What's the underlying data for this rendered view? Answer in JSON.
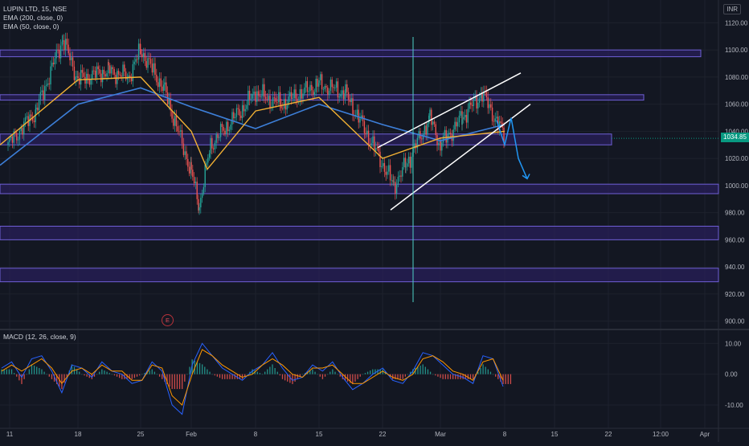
{
  "header": {
    "symbol_title": "LUPIN LTD, 15, NSE",
    "indicator_ema200": "EMA (200, close, 0)",
    "indicator_ema50": "EMA (50, close, 0)",
    "currency": "INR",
    "macd_label": "MACD (12, 26, close, 9)",
    "earnings_marker": "E",
    "last_price": "1034.85"
  },
  "colors": {
    "background": "#131722",
    "grid": "#1e222d",
    "zone_fill": "#2a1f5c",
    "zone_border": "#6f5fd6",
    "ema200": "#3d7fd9",
    "ema50": "#f2b134",
    "candle_up": "#26a69a",
    "candle_down": "#ef5350",
    "channel": "#ffffff",
    "projection": "#2196f3",
    "cursor_line": "#4dd0c5",
    "macd_line": "#2962ff",
    "signal_line": "#ff9800",
    "price_tag": "#089981"
  },
  "chart_data": [
    {
      "type": "candlestick",
      "title": "LUPIN LTD, 15, NSE",
      "x_tick_labels": [
        "11",
        "18",
        "25",
        "Feb",
        "8",
        "15",
        "22",
        "Mar",
        "8",
        "15",
        "22",
        "12:00",
        "Apr"
      ],
      "y_tick_labels": [
        "1120.00",
        "1100.00",
        "1080.00",
        "1060.00",
        "1040.00",
        "1020.00",
        "1000.00",
        "980.00",
        "960.00",
        "940.00",
        "920.00",
        "900.00"
      ],
      "ylim": [
        895,
        1125
      ],
      "grid": true,
      "last_price": 1034.85,
      "horizontal_zones": [
        {
          "low": 1095,
          "high": 1100
        },
        {
          "low": 1063,
          "high": 1067
        },
        {
          "low": 1030,
          "high": 1038
        },
        {
          "low": 994,
          "high": 1001
        },
        {
          "low": 960,
          "high": 970
        },
        {
          "low": 929,
          "high": 939
        }
      ],
      "price_anchors": [
        {
          "x": "11",
          "price": 1030
        },
        {
          "x": "14",
          "price": 1055
        },
        {
          "x": "17",
          "price": 1108
        },
        {
          "x": "18",
          "price": 1078
        },
        {
          "x": "21",
          "price": 1085
        },
        {
          "x": "24",
          "price": 1080
        },
        {
          "x": "25",
          "price": 1100
        },
        {
          "x": "28",
          "price": 1070
        },
        {
          "x": "Feb",
          "price": 1010
        },
        {
          "x": "2",
          "price": 985
        },
        {
          "x": "4",
          "price": 1030
        },
        {
          "x": "8",
          "price": 1068
        },
        {
          "x": "11",
          "price": 1060
        },
        {
          "x": "15",
          "price": 1075
        },
        {
          "x": "16",
          "price": 1068
        },
        {
          "x": "19",
          "price": 1040
        },
        {
          "x": "22",
          "price": 1000
        },
        {
          "x": "24",
          "price": 1015
        },
        {
          "x": "27",
          "price": 1050
        },
        {
          "x": "Mar",
          "price": 1030
        },
        {
          "x": "3",
          "price": 1050
        },
        {
          "x": "6",
          "price": 1068
        },
        {
          "x": "8",
          "price": 1036
        }
      ],
      "ema_anchors": {
        "ema200": [
          {
            "x": "11",
            "price": 1015
          },
          {
            "x": "18",
            "price": 1060
          },
          {
            "x": "25",
            "price": 1072
          },
          {
            "x": "Feb",
            "price": 1058
          },
          {
            "x": "8",
            "price": 1042
          },
          {
            "x": "15",
            "price": 1060
          },
          {
            "x": "22",
            "price": 1045
          },
          {
            "x": "Mar",
            "price": 1033
          },
          {
            "x": "8",
            "price": 1045
          }
        ],
        "ema50": [
          {
            "x": "11",
            "price": 1030
          },
          {
            "x": "18",
            "price": 1078
          },
          {
            "x": "25",
            "price": 1080
          },
          {
            "x": "Feb",
            "price": 1040
          },
          {
            "x": "3",
            "price": 1012
          },
          {
            "x": "8",
            "price": 1055
          },
          {
            "x": "15",
            "price": 1065
          },
          {
            "x": "22",
            "price": 1020
          },
          {
            "x": "Mar",
            "price": 1035
          },
          {
            "x": "8",
            "price": 1040
          }
        ]
      },
      "rising_wedge": {
        "upper": [
          {
            "x": "21",
            "price": 1028
          },
          {
            "x": "11",
            "price": 1083
          }
        ],
        "lower": [
          {
            "x": "21",
            "price": 982
          },
          {
            "x": "12",
            "price": 1060
          }
        ]
      },
      "projection_path": [
        1048,
        1030,
        1050,
        1020,
        1005
      ]
    },
    {
      "type": "line",
      "title": "MACD (12, 26, close, 9)",
      "y_tick_labels": [
        "10.00",
        "0.00",
        "-10.00"
      ],
      "ylim": [
        -16,
        14
      ],
      "series": [
        {
          "name": "MACD",
          "values": [
            2,
            4,
            -1,
            5,
            6,
            1,
            -6,
            3,
            2,
            -1,
            4,
            1,
            0,
            -3,
            -2,
            4,
            1,
            -10,
            -13,
            3,
            10,
            6,
            2,
            0,
            -2,
            1,
            3,
            7,
            2,
            -2,
            -1,
            3,
            1,
            4,
            -1,
            -5,
            -3,
            0,
            2,
            -2,
            -3,
            1,
            7,
            6,
            3,
            0,
            -1,
            -3,
            6,
            5,
            -4
          ]
        },
        {
          "name": "Signal",
          "values": [
            1,
            3,
            1,
            3,
            5,
            2,
            -3,
            1,
            2,
            0,
            3,
            1,
            1,
            -2,
            -2,
            3,
            2,
            -7,
            -10,
            0,
            8,
            6,
            3,
            1,
            -1,
            0,
            3,
            5,
            3,
            0,
            -1,
            2,
            2,
            3,
            0,
            -3,
            -3,
            -1,
            1,
            -1,
            -2,
            0,
            5,
            6,
            4,
            1,
            0,
            -2,
            4,
            5,
            -2
          ]
        }
      ],
      "histogram_note": "bars colored green above zero, red below zero"
    }
  ]
}
